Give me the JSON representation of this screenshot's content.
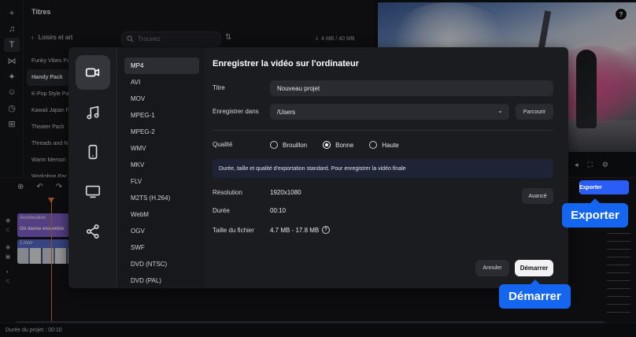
{
  "titles_panel": {
    "title": "Titres",
    "back_label": "Loisirs et art",
    "search_placeholder": "Trouvez",
    "storage": "4 MB / 40 MB",
    "packs": [
      "Funky Vibes Pa",
      "Handy Pack",
      "K-Pop Style Pa",
      "Kawaii Japan P",
      "Theater Pack",
      "Threads and N",
      "Warm Memori",
      "Workshop Pac"
    ]
  },
  "help_icon": "?",
  "export_button": {
    "label": "Exporter"
  },
  "callouts": {
    "exporter": "Exporter",
    "demarrer": "Démarrer"
  },
  "timeline": {
    "title_clip": "Acceleration",
    "title_clip_sub": "On danse ensemble",
    "video_clip": "1.mov"
  },
  "status": {
    "duration": "Durée du projet : 00:10"
  },
  "dialog": {
    "heading": "Enregistrer la vidéo sur l'ordinateur",
    "formats": [
      "MP4",
      "AVI",
      "MOV",
      "MPEG-1",
      "MPEG-2",
      "WMV",
      "MKV",
      "FLV",
      "M2TS (H.264)",
      "WebM",
      "OGV",
      "SWF",
      "DVD (NTSC)",
      "DVD (PAL)"
    ],
    "title_label": "Titre",
    "title_value": "Nouveau projet",
    "save_in_label": "Enregistrer dans",
    "save_in_value": "/Users",
    "browse_label": "Parcourir",
    "quality_label": "Qualité",
    "quality_options": [
      "Brouillon",
      "Bonne",
      "Haute"
    ],
    "quality_selected": "Bonne",
    "info_text": "Durée, taille et qualité d'exportation standard. Pour enregistrer la vidéo finale",
    "resolution_label": "Résolution",
    "resolution_value": "1920x1080",
    "advanced_label": "Avancé",
    "duration_label": "Durée",
    "duration_value": "00:10",
    "filesize_label": "Taille du fichier",
    "filesize_value": "4.7 MB - 17.8 MB",
    "cancel_label": "Annuler",
    "start_label": "Démarrer"
  }
}
